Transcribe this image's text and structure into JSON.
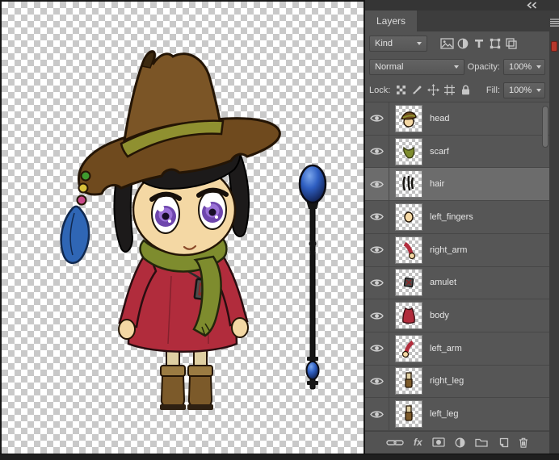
{
  "panel": {
    "tab_label": "Layers",
    "filter_row": {
      "kind_label": "Kind",
      "filter_types": [
        "pixel-layers",
        "adjustment-layers",
        "type-layers",
        "shape-layers",
        "smart-objects"
      ],
      "filter_toggle_color": "#b6382c"
    },
    "blend_row": {
      "blend_mode": "Normal",
      "opacity_label": "Opacity:",
      "opacity_value": "100%"
    },
    "lock_row": {
      "lock_label": "Lock:",
      "lock_types": [
        "lock-transparent-pixels",
        "lock-image-pixels",
        "lock-position",
        "lock-artboards",
        "lock-all"
      ],
      "fill_label": "Fill:",
      "fill_value": "100%"
    },
    "layers": [
      {
        "name": "head",
        "visible": true,
        "selected": false
      },
      {
        "name": "scarf",
        "visible": true,
        "selected": false
      },
      {
        "name": "hair",
        "visible": true,
        "selected": true
      },
      {
        "name": "left_fingers",
        "visible": true,
        "selected": false
      },
      {
        "name": "right_arm",
        "visible": true,
        "selected": false
      },
      {
        "name": "amulet",
        "visible": true,
        "selected": false
      },
      {
        "name": "body",
        "visible": true,
        "selected": false
      },
      {
        "name": "left_arm",
        "visible": true,
        "selected": false
      },
      {
        "name": "right_leg",
        "visible": true,
        "selected": false
      },
      {
        "name": "left_leg",
        "visible": true,
        "selected": false
      }
    ],
    "footer": {
      "fx_label": "fx",
      "tools": [
        "link-layers",
        "layer-style",
        "add-layer-mask",
        "new-adjustment-layer",
        "new-group",
        "new-layer",
        "delete-layer"
      ]
    }
  },
  "canvas": {
    "content": "chibi witch character with beaded hat and blue orb staff on transparent checkerboard",
    "checker_light": "#ffffff",
    "checker_dark": "#c9c9c9",
    "palette": {
      "hat": "#6f4a1e",
      "hat_band": "#8f9030",
      "hair": "#1c1a1a",
      "skin": "#f4d8a4",
      "eyes": "#7b51b8",
      "scarf": "#7e8c2e",
      "dress": "#b12c3c",
      "boots": "#7c5a2a",
      "feather": "#2f66b5",
      "staff_orb": "#2f5fc2"
    }
  }
}
